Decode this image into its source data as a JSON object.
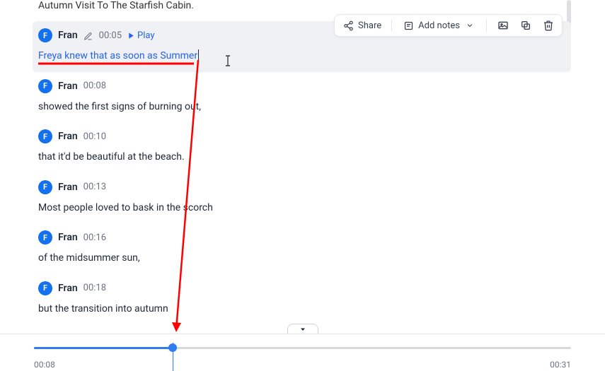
{
  "header": {
    "title": "Autumn Visit To The Starfish Cabin."
  },
  "toolbar": {
    "share": "Share",
    "add_notes": "Add notes"
  },
  "transcript": {
    "segments": [
      {
        "avatar": "F",
        "speaker": "Fran",
        "time": "00:05",
        "play_label": "Play",
        "text": "Freya knew that as soon as Summer",
        "active": true
      },
      {
        "avatar": "F",
        "speaker": "Fran",
        "time": "00:08",
        "text": "showed the first signs of burning out,"
      },
      {
        "avatar": "F",
        "speaker": "Fran",
        "time": "00:10",
        "text": "that it'd be beautiful at the beach."
      },
      {
        "avatar": "F",
        "speaker": "Fran",
        "time": "00:13",
        "text": "Most people loved to bask in the scorch"
      },
      {
        "avatar": "F",
        "speaker": "Fran",
        "time": "00:16",
        "text": "of the midsummer sun,"
      },
      {
        "avatar": "F",
        "speaker": "Fran",
        "time": "00:18",
        "text": "but the transition into autumn"
      }
    ]
  },
  "player": {
    "current_time": "00:08",
    "total_time": "00:31",
    "progress_pct": 25.8
  }
}
